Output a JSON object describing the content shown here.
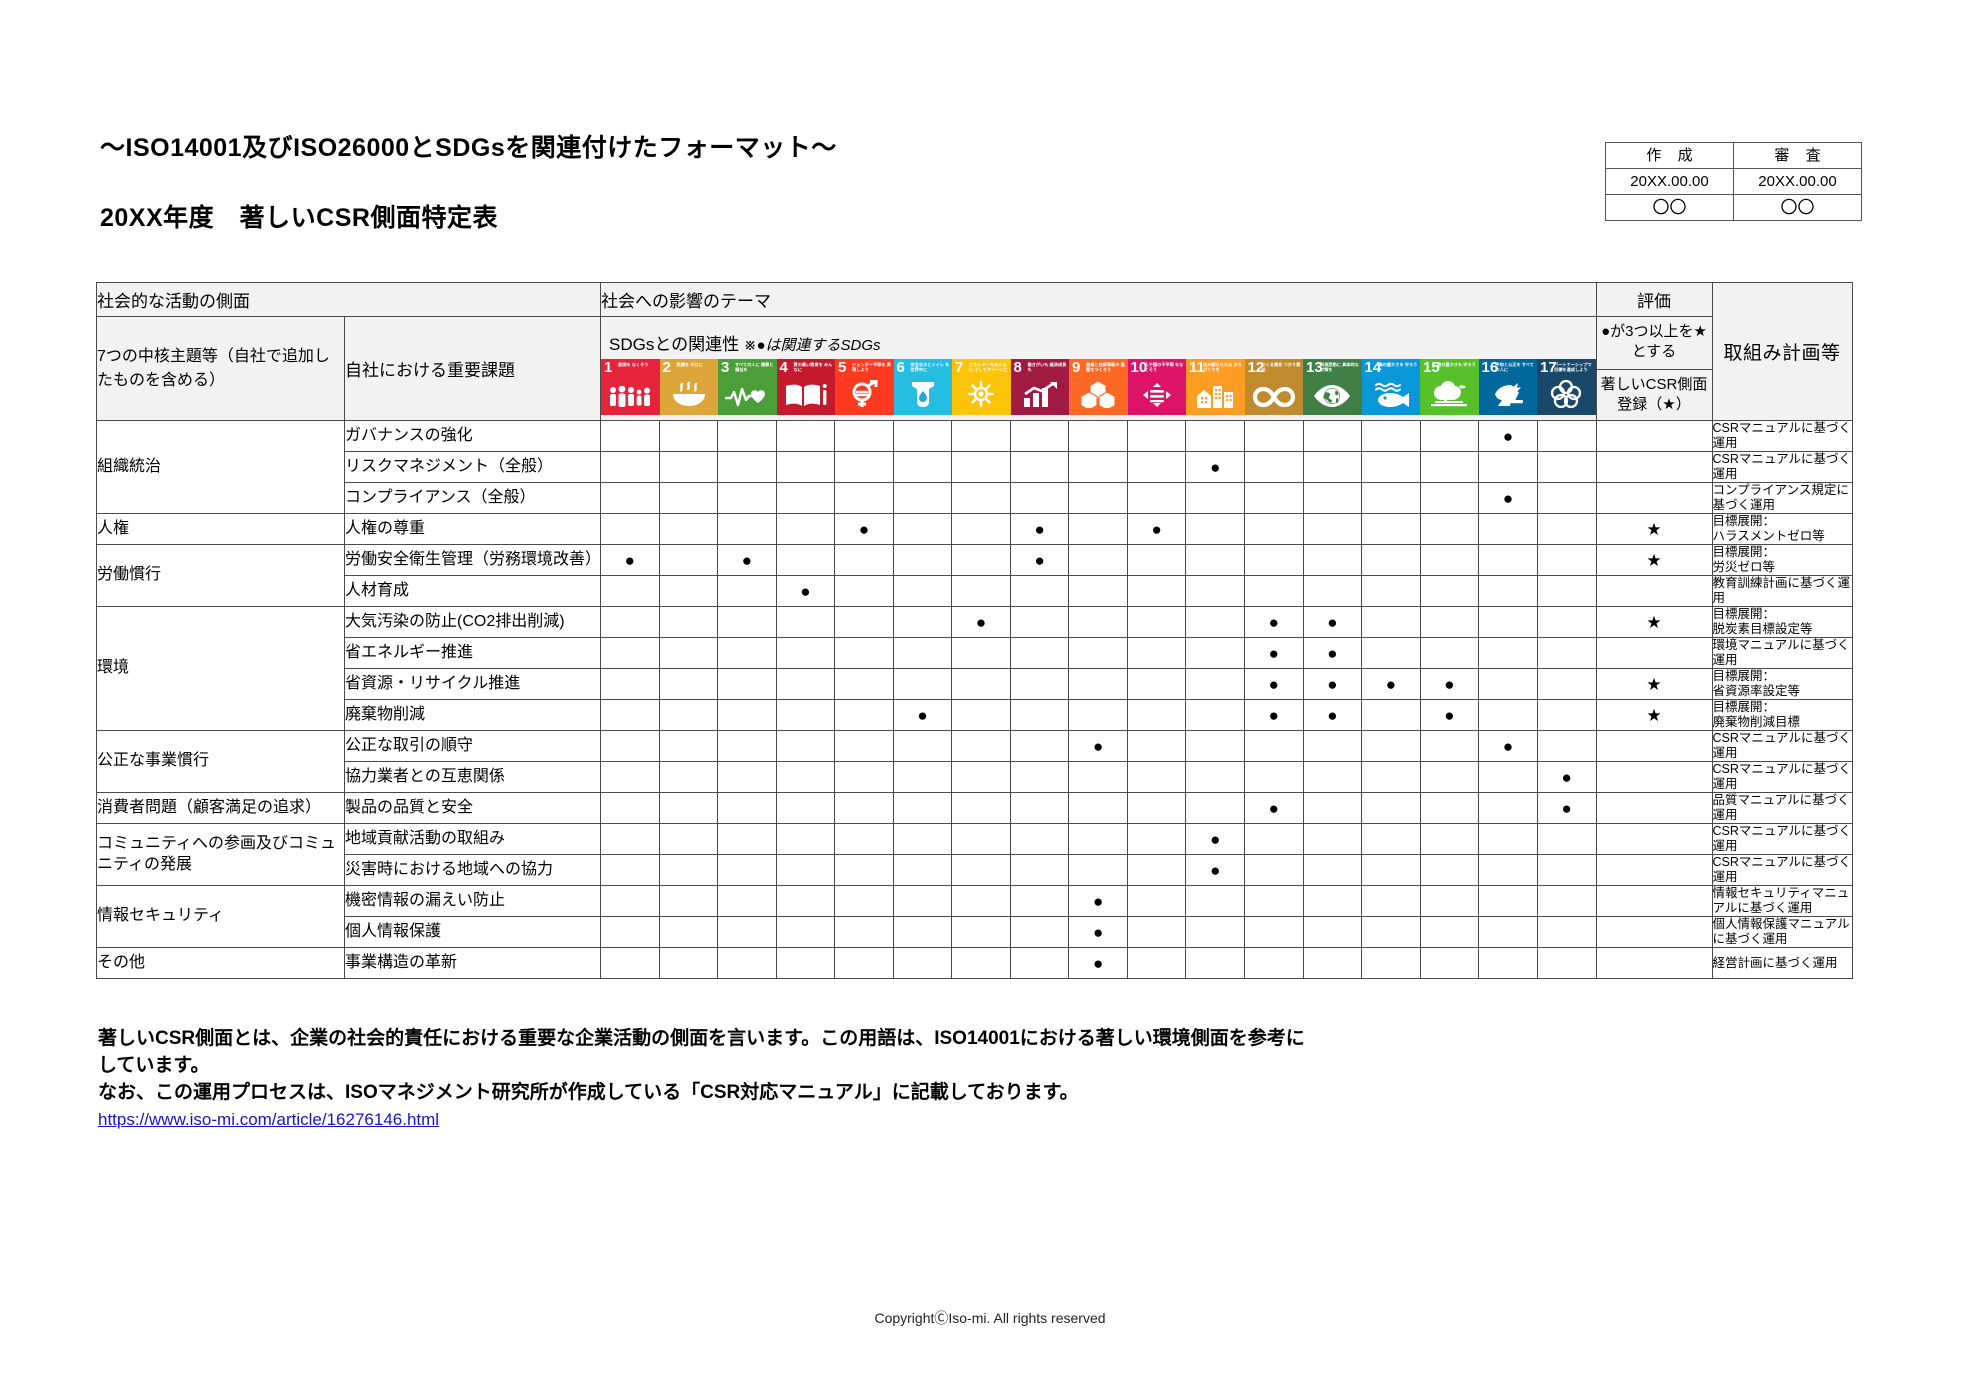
{
  "document": {
    "subtitle": "～ISO14001及びISO26000とSDGsを関連付けたフォーマット～",
    "title": "20XX年度　著しいCSR側面特定表",
    "copyright": "CopyrightⒸIso-mi. All rights reserved"
  },
  "approval": {
    "columns": [
      "作 成",
      "審 査"
    ],
    "dates": [
      "20XX.00.00",
      "20XX.00.00"
    ],
    "signatures": [
      "〇〇",
      "〇〇"
    ]
  },
  "table_headers": {
    "aspect_group": "社会的な活動の側面",
    "impact_group": "社会への影響のテーマ",
    "evaluation_group": "評価",
    "core_subjects": "7つの中核主題等（自社で追加したものを含める）",
    "key_issues": "自社における重要課題",
    "sdg_relation": "SDGsとの関連性",
    "sdg_relation_note": "※●は関連するSDGs",
    "eval_rule": "●が3つ以上を★とする",
    "eval_register": "著しいCSR側面登録（★）",
    "action_plan": "取組み計画等"
  },
  "sdgs": [
    {
      "no": "1",
      "title": "貧困を\nなくそう",
      "color": "#E5243B",
      "glyph": "people-icon"
    },
    {
      "no": "2",
      "title": "飢餓を\nゼロに",
      "color": "#DDA63A",
      "glyph": "bowl-icon"
    },
    {
      "no": "3",
      "title": "すべての人に\n健康と福祉を",
      "color": "#4C9F38",
      "glyph": "heartbeat-icon"
    },
    {
      "no": "4",
      "title": "質の高い教育を\nみんなに",
      "color": "#C5192D",
      "glyph": "book-icon"
    },
    {
      "no": "5",
      "title": "ジェンダー平等を\n実現しよう",
      "color": "#FF3A21",
      "glyph": "gender-icon"
    },
    {
      "no": "6",
      "title": "安全な水とトイレ\nを世界中に",
      "color": "#26BDE2",
      "glyph": "water-icon"
    },
    {
      "no": "7",
      "title": "エネルギーをみんなに\nそしてクリーンに",
      "color": "#FCC30B",
      "glyph": "sun-icon"
    },
    {
      "no": "8",
      "title": "働きがいも\n経済成長も",
      "color": "#A21942",
      "glyph": "growth-chart-icon"
    },
    {
      "no": "9",
      "title": "産業と技術革新の\n基盤をつくろう",
      "color": "#FD6925",
      "glyph": "cubes-icon"
    },
    {
      "no": "10",
      "title": "人や国の不平等\nをなくそう",
      "color": "#DD1367",
      "glyph": "equals-arrows-icon"
    },
    {
      "no": "11",
      "title": "住み続けられる\nまちづくりを",
      "color": "#FD9D24",
      "glyph": "city-icon"
    },
    {
      "no": "12",
      "title": "つくる責任\nつかう責任",
      "color": "#BF8B2E",
      "glyph": "infinity-icon"
    },
    {
      "no": "13",
      "title": "気候変動に\n具体的な対策を",
      "color": "#3F7E44",
      "glyph": "eye-earth-icon"
    },
    {
      "no": "14",
      "title": "海の豊かさを\n守ろう",
      "color": "#0A97D9",
      "glyph": "fish-icon"
    },
    {
      "no": "15",
      "title": "陸の豊かさも\n守ろう",
      "color": "#56C02B",
      "glyph": "tree-bird-icon"
    },
    {
      "no": "16",
      "title": "平和と公正を\nすべての人に",
      "color": "#00689D",
      "glyph": "dove-gavel-icon"
    },
    {
      "no": "17",
      "title": "パートナーシップで\n目標を達成しよう",
      "color": "#19486A",
      "glyph": "circles-icon"
    }
  ],
  "mark_symbol": "●",
  "star_symbol": "★",
  "rows": [
    {
      "core": "組織統治",
      "core_rowspan": 3,
      "issue": "ガバナンスの強化",
      "sdgs": [
        16
      ],
      "star": "",
      "plan": "CSRマニュアルに基づく運用",
      "group_start": true
    },
    {
      "core": "",
      "core_rowspan": 0,
      "issue": "リスクマネジメント（全般）",
      "sdgs": [
        11
      ],
      "star": "",
      "plan": "CSRマニュアルに基づく運用",
      "group_start": false
    },
    {
      "core": "",
      "core_rowspan": 0,
      "issue": "コンプライアンス（全般）",
      "sdgs": [
        16
      ],
      "star": "",
      "plan": "コンプライアンス規定に基づく運用",
      "group_start": false
    },
    {
      "core": "人権",
      "core_rowspan": 1,
      "issue": "人権の尊重",
      "sdgs": [
        5,
        8,
        10
      ],
      "star": "★",
      "plan": "目標展開：\nハラスメントゼロ等",
      "group_start": true
    },
    {
      "core": "労働慣行",
      "core_rowspan": 2,
      "issue": "労働安全衛生管理（労務環境改善）",
      "sdgs": [
        1,
        3,
        8
      ],
      "star": "★",
      "plan": "目標展開：\n労災ゼロ等",
      "group_start": true
    },
    {
      "core": "",
      "core_rowspan": 0,
      "issue": "人材育成",
      "sdgs": [
        4
      ],
      "star": "",
      "plan": "教育訓練計画に基づく運用",
      "group_start": false
    },
    {
      "core": "環境",
      "core_rowspan": 4,
      "issue": "大気汚染の防止(CO2排出削減)",
      "sdgs": [
        7,
        12,
        13
      ],
      "star": "★",
      "plan": "目標展開：\n脱炭素目標設定等",
      "group_start": true
    },
    {
      "core": "",
      "core_rowspan": 0,
      "issue": "省エネルギー推進",
      "sdgs": [
        12,
        13
      ],
      "star": "",
      "plan": "環境マニュアルに基づく運用",
      "group_start": false
    },
    {
      "core": "",
      "core_rowspan": 0,
      "issue": "省資源・リサイクル推進",
      "sdgs": [
        12,
        13,
        14,
        15
      ],
      "star": "★",
      "plan": "目標展開：\n省資源率設定等",
      "group_start": false
    },
    {
      "core": "",
      "core_rowspan": 0,
      "issue": "廃棄物削減",
      "sdgs": [
        6,
        12,
        13,
        15
      ],
      "star": "★",
      "plan": "目標展開：\n廃棄物削減目標",
      "group_start": false
    },
    {
      "core": "公正な事業慣行",
      "core_rowspan": 2,
      "issue": "公正な取引の順守",
      "sdgs": [
        9,
        16
      ],
      "star": "",
      "plan": "CSRマニュアルに基づく運用",
      "group_start": true
    },
    {
      "core": "",
      "core_rowspan": 0,
      "issue": "協力業者との互恵関係",
      "sdgs": [
        17
      ],
      "star": "",
      "plan": "CSRマニュアルに基づく運用",
      "group_start": false
    },
    {
      "core": "消費者問題（顧客満足の追求）",
      "core_rowspan": 1,
      "issue": "製品の品質と安全",
      "sdgs": [
        12,
        17
      ],
      "star": "",
      "plan": "品質マニュアルに基づく運用",
      "group_start": true
    },
    {
      "core": "コミュニティへの参画及びコミュニティの発展",
      "core_rowspan": 2,
      "issue": "地域貢献活動の取組み",
      "sdgs": [
        11
      ],
      "star": "",
      "plan": "CSRマニュアルに基づく運用",
      "group_start": true
    },
    {
      "core": "",
      "core_rowspan": 0,
      "issue": "災害時における地域への協力",
      "sdgs": [
        11
      ],
      "star": "",
      "plan": "CSRマニュアルに基づく運用",
      "group_start": false
    },
    {
      "core": "情報セキュリティ",
      "core_rowspan": 2,
      "issue": "機密情報の漏えい防止",
      "sdgs": [
        9
      ],
      "star": "",
      "plan": "情報セキュリティマニュアルに基づく運用",
      "group_start": true
    },
    {
      "core": "",
      "core_rowspan": 0,
      "issue": "個人情報保護",
      "sdgs": [
        9
      ],
      "star": "",
      "plan": "個人情報保護マニュアルに基づく運用",
      "group_start": false
    },
    {
      "core": "その他",
      "core_rowspan": 1,
      "issue": "事業構造の革新",
      "sdgs": [
        9
      ],
      "star": "",
      "plan": "経営計画に基づく運用",
      "group_start": true
    }
  ],
  "notes": {
    "line1": "著しいCSR側面とは、企業の社会的責任における重要な企業活動の側面を言います。この用語は、ISO14001における著しい環境側面を参考に",
    "line2": "しています。",
    "line3": "なお、この運用プロセスは、ISOマネジメント研究所が作成している「CSR対応マニュアル」に記載しております。",
    "link": "https://www.iso-mi.com/article/16276146.html"
  }
}
